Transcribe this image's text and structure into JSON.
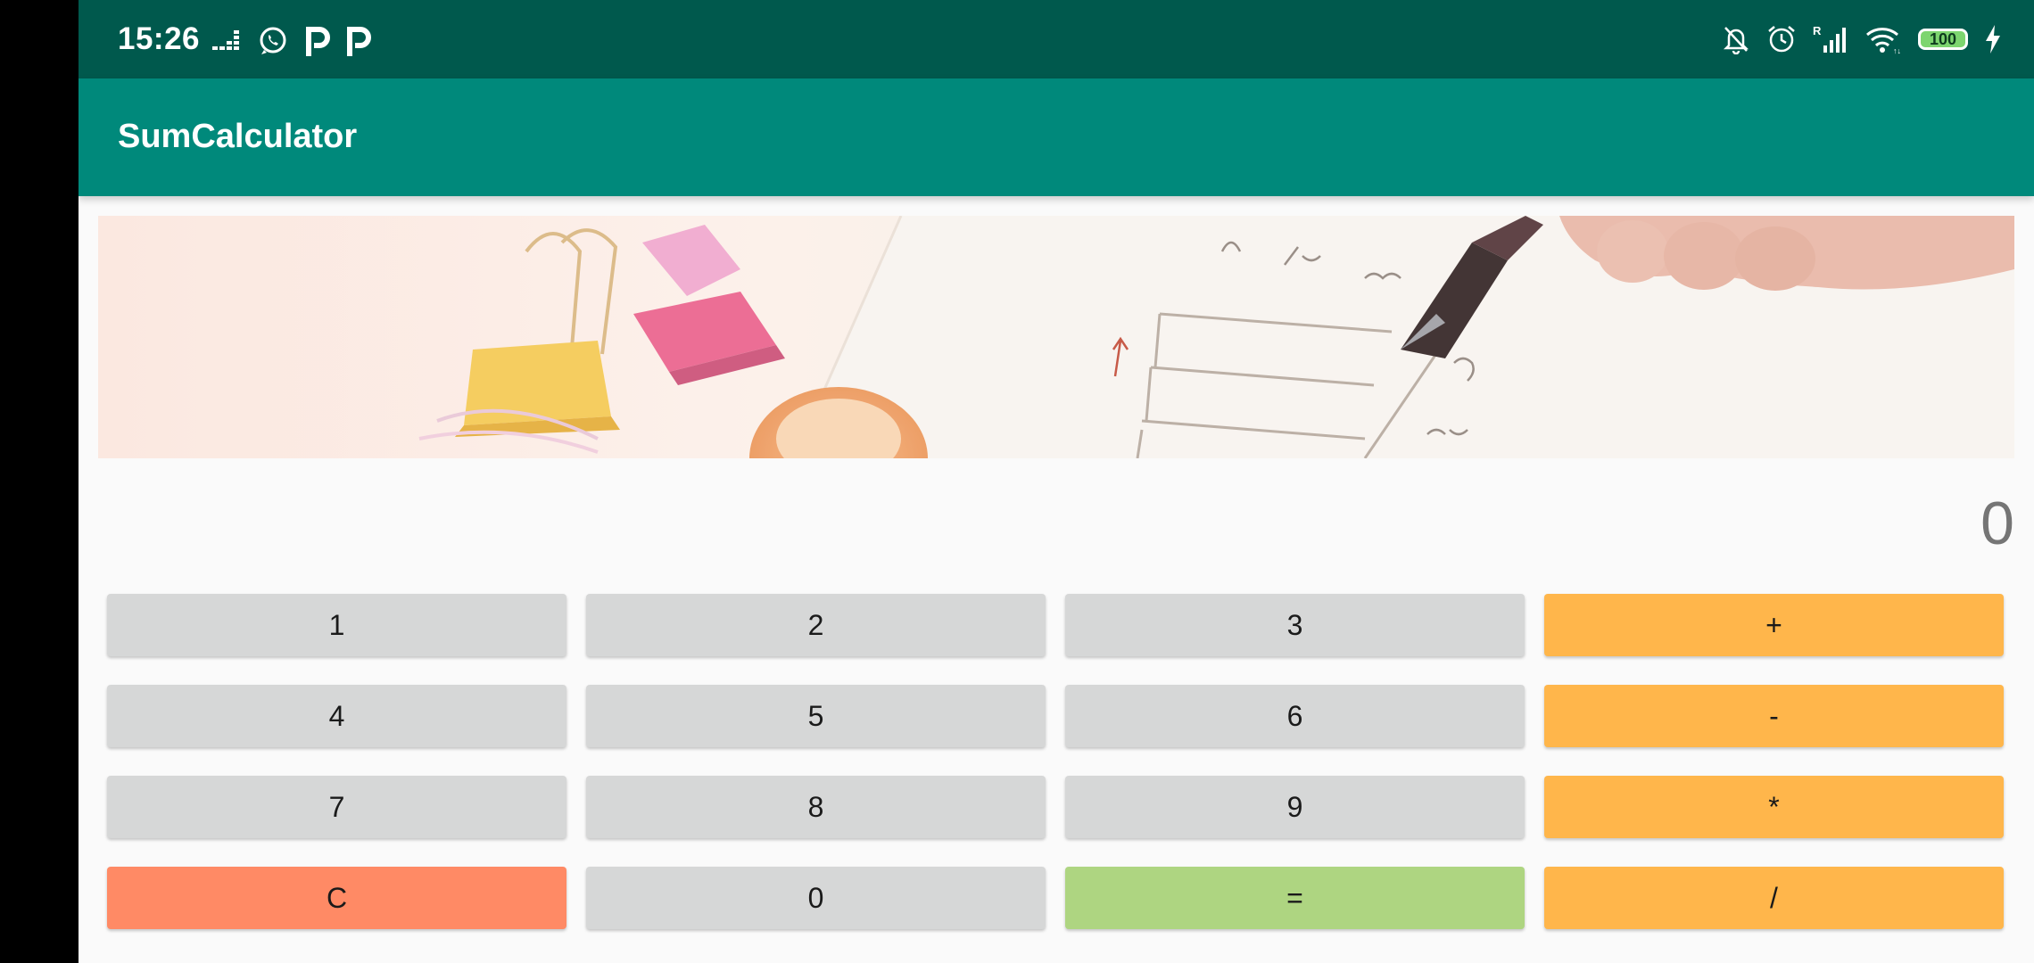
{
  "status_bar": {
    "time": "15:26",
    "battery": "100",
    "left_icons": [
      "deezer-icon",
      "whatsapp-icon",
      "p-app-icon",
      "p-app-icon"
    ],
    "right_icons": [
      "bell-off-icon",
      "alarm-icon",
      "signal-icon",
      "wifi-icon",
      "battery-icon",
      "charging-icon"
    ]
  },
  "app_bar": {
    "title": "SumCalculator"
  },
  "display": {
    "value": "0"
  },
  "keypad": {
    "rows": [
      [
        {
          "label": "1",
          "kind": "num"
        },
        {
          "label": "2",
          "kind": "num"
        },
        {
          "label": "3",
          "kind": "num"
        },
        {
          "label": "+",
          "kind": "op"
        }
      ],
      [
        {
          "label": "4",
          "kind": "num"
        },
        {
          "label": "5",
          "kind": "num"
        },
        {
          "label": "6",
          "kind": "num"
        },
        {
          "label": "-",
          "kind": "op"
        }
      ],
      [
        {
          "label": "7",
          "kind": "num"
        },
        {
          "label": "8",
          "kind": "num"
        },
        {
          "label": "9",
          "kind": "num"
        },
        {
          "label": "*",
          "kind": "op"
        }
      ],
      [
        {
          "label": "C",
          "kind": "clear"
        },
        {
          "label": "0",
          "kind": "num"
        },
        {
          "label": "=",
          "kind": "equals"
        },
        {
          "label": "/",
          "kind": "op"
        }
      ]
    ]
  },
  "colors": {
    "status_bar": "#00594d",
    "app_bar": "#00897b",
    "number_key": "#d6d7d7",
    "operator_key": "#ffb64b",
    "clear_key": "#ff8a65",
    "equals_key": "#aed581"
  }
}
